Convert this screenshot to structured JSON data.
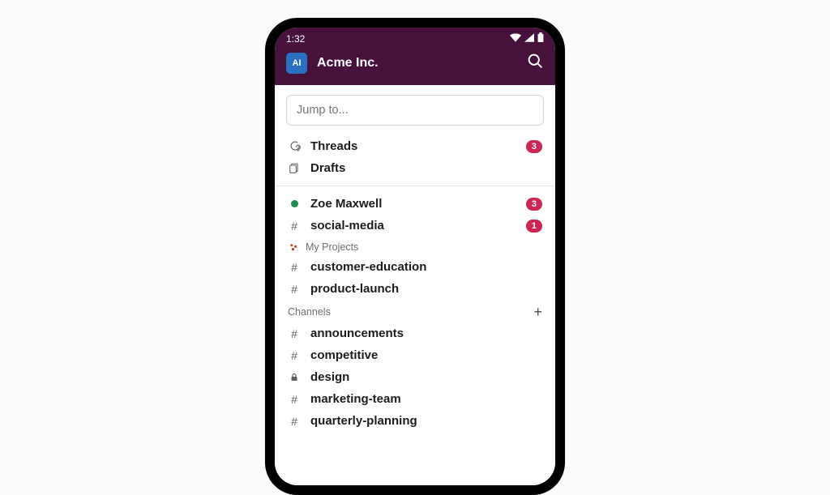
{
  "status": {
    "time": "1:32"
  },
  "workspace": {
    "initials": "AI",
    "name": "Acme Inc."
  },
  "jump": {
    "placeholder": "Jump to..."
  },
  "nav": {
    "threads": {
      "label": "Threads",
      "badge": "3"
    },
    "drafts": {
      "label": "Drafts"
    }
  },
  "unreads": [
    {
      "type": "dm",
      "label": "Zoe Maxwell",
      "badge": "3"
    },
    {
      "type": "channel",
      "label": "social-media",
      "badge": "1"
    }
  ],
  "sections": {
    "myprojects": {
      "title": "My Projects",
      "items": [
        {
          "icon": "hash",
          "label": "customer-education"
        },
        {
          "icon": "hash",
          "label": "product-launch"
        }
      ]
    },
    "channels": {
      "title": "Channels",
      "items": [
        {
          "icon": "hash",
          "label": "announcements"
        },
        {
          "icon": "hash",
          "label": "competitive"
        },
        {
          "icon": "lock",
          "label": "design"
        },
        {
          "icon": "hash",
          "label": "marketing-team"
        },
        {
          "icon": "hash",
          "label": "quarterly-planning"
        }
      ]
    }
  }
}
